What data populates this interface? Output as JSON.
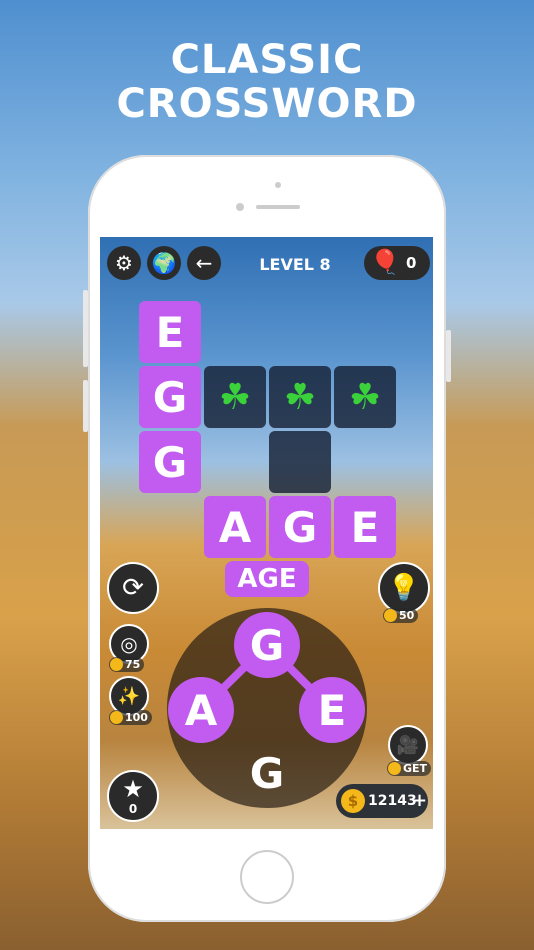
{
  "headline": {
    "line1": "CLASSIC",
    "line2": "CROSSWORD"
  },
  "header": {
    "level": "LEVEL 8",
    "balloons": "0"
  },
  "grid": {
    "row1": [
      "E"
    ],
    "row2": [
      "G"
    ],
    "row3": [
      "G"
    ],
    "row4": [
      "A",
      "G",
      "E"
    ],
    "hint_icon": "clover-icon"
  },
  "current_word": "AGE",
  "wheel": {
    "letters": [
      "G",
      "A",
      "E",
      "G"
    ]
  },
  "tools": {
    "lightbulb_cost": "50",
    "target_cost": "75",
    "fireworks_cost": "100",
    "video_label": "GET",
    "stars": "0",
    "coins": "12143",
    "coins_plus": "+"
  },
  "colors": {
    "accent": "#c25bf0"
  }
}
